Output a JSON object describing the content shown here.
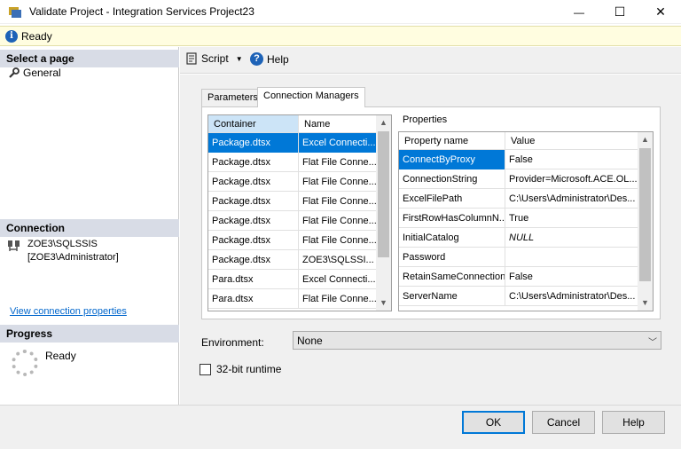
{
  "window": {
    "title": "Validate Project - Integration Services Project23",
    "minimize_glyph": "—",
    "maximize_glyph": "☐",
    "close_glyph": "✕"
  },
  "status": {
    "icon": "i",
    "text": "Ready"
  },
  "sidebar": {
    "select_page_header": "Select a page",
    "pages": [
      {
        "label": "General",
        "icon": "wrench-icon"
      }
    ],
    "connection_header": "Connection",
    "server": "ZOE3\\SQLSSIS",
    "user": "[ZOE3\\Administrator]",
    "view_link": "View connection properties",
    "progress_header": "Progress",
    "progress_text": "Ready"
  },
  "toolbar": {
    "script_label": "Script",
    "help_label": "Help",
    "help_icon": "?"
  },
  "tabs": {
    "parameters": "Parameters",
    "connection_managers": "Connection Managers"
  },
  "connections": {
    "headers": {
      "container": "Container",
      "name": "Name"
    },
    "rows": [
      {
        "container": "Package.dtsx",
        "name": "Excel Connecti..."
      },
      {
        "container": "Package.dtsx",
        "name": "Flat File Conne..."
      },
      {
        "container": "Package.dtsx",
        "name": "Flat File Conne..."
      },
      {
        "container": "Package.dtsx",
        "name": "Flat File Conne..."
      },
      {
        "container": "Package.dtsx",
        "name": "Flat File Conne..."
      },
      {
        "container": "Package.dtsx",
        "name": "Flat File Conne..."
      },
      {
        "container": "Package.dtsx",
        "name": "ZOE3\\SQLSSI..."
      },
      {
        "container": "Para.dtsx",
        "name": "Excel Connecti..."
      },
      {
        "container": "Para.dtsx",
        "name": "Flat File Conne..."
      }
    ],
    "selected_index": 0
  },
  "properties": {
    "label": "Properties",
    "headers": {
      "name": "Property name",
      "value": "Value"
    },
    "rows": [
      {
        "name": "ConnectByProxy",
        "value": "False"
      },
      {
        "name": "ConnectionString",
        "value": "Provider=Microsoft.ACE.OL..."
      },
      {
        "name": "ExcelFilePath",
        "value": "C:\\Users\\Administrator\\Des..."
      },
      {
        "name": "FirstRowHasColumnN...",
        "value": "True"
      },
      {
        "name": "InitialCatalog",
        "value": "NULL"
      },
      {
        "name": "Password",
        "value": ""
      },
      {
        "name": "RetainSameConnection",
        "value": "False"
      },
      {
        "name": "ServerName",
        "value": "C:\\Users\\Administrator\\Des..."
      }
    ],
    "selected_index": 0
  },
  "environment": {
    "label": "Environment:",
    "value": "None"
  },
  "runtime": {
    "label": "32-bit runtime",
    "checked": false
  },
  "buttons": {
    "ok": "OK",
    "cancel": "Cancel",
    "help": "Help"
  },
  "colors": {
    "selection": "#0078d7",
    "status_bg": "#fffde0",
    "section_header": "#d8dce6",
    "link": "#0066cc"
  }
}
